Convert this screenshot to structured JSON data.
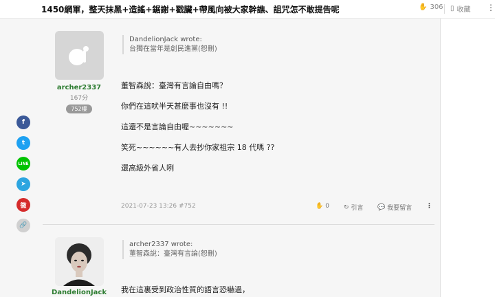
{
  "topbar": {
    "title": "1450網軍，整天抹黑+造謠+鋸謝+戳臟+帶風向被大家幹譙、詛咒怎不敢提告呢",
    "like_count": "306",
    "bookmark_label": "收藏"
  },
  "social": {
    "facebook": "f",
    "twitter": "t",
    "line": "LINE",
    "telegram": "➤",
    "weibo": "微",
    "link": "🔗"
  },
  "posts": [
    {
      "username": "archer2337",
      "points": "167分",
      "floor_badge": "752樓",
      "quote_author": "DandelionJack wrote:",
      "quote_text": "台獨在當年是創民進黨(恕刪)",
      "lines": [
        "董智森說：臺灣有言論自由嗎？",
        "你們在這吠半天甚麼事也沒有 !!",
        "這還不是言論自由喔~~~~~~~",
        "笑死~~~~~~有人去抄你家祖宗 18 代嗎 ??",
        "還高級外省人咧"
      ],
      "meta": "2021-07-23 13:26 #752",
      "like_count": "0",
      "quote_label": "引言",
      "reply_label": "我要留言"
    },
    {
      "username": "DandelionJack",
      "quote_author": "archer2337 wrote:",
      "quote_text": "董智森說：臺灣有言論(恕刪)",
      "lines": [
        "我在這裏受到政治性質的語言恐嚇過，"
      ]
    }
  ]
}
